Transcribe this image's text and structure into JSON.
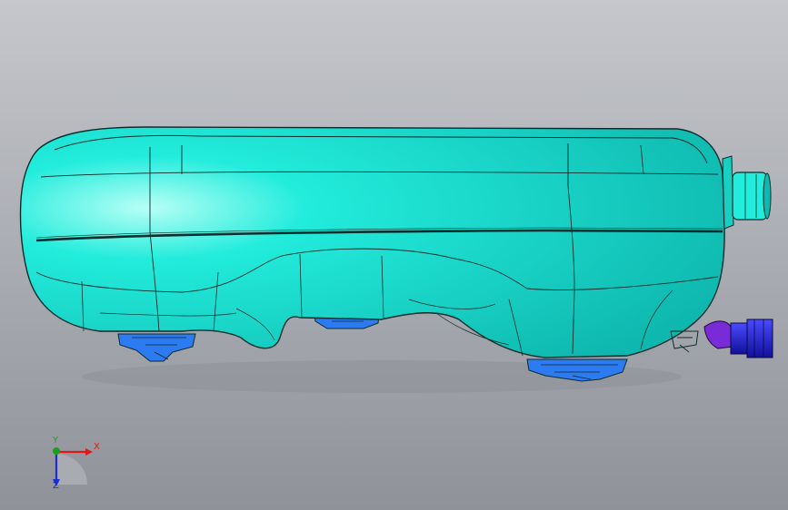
{
  "viewport": {
    "background_top": "#c5c7cc",
    "background_bottom": "#8f9299"
  },
  "model": {
    "name": "fuel-tank",
    "body_color": "#22ecdc",
    "body_highlight": "#b8fff6",
    "body_shadow": "#0fb8ae",
    "edge_color": "#0b2d2b",
    "bracket_color": "#2c7bf2",
    "connector_color": "#2020d8",
    "connector_elbow_color": "#7a2bd8"
  },
  "triad": {
    "x_label": "X",
    "y_label": "Y",
    "z_label": "Z",
    "x_color": "#e01818",
    "y_color": "#1aa01a",
    "z_color": "#1a2bd8"
  }
}
